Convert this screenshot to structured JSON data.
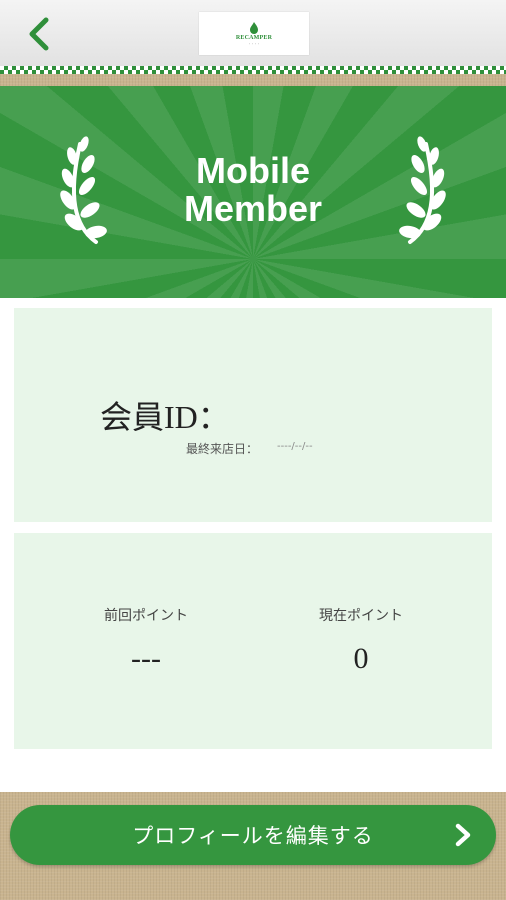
{
  "header": {
    "back_icon": "chevron-left-icon",
    "logo_text": "RECAMPER",
    "logo_subtext": "・・・・"
  },
  "banner": {
    "title_line1": "Mobile",
    "title_line2": "Member",
    "wreath_icon": "laurel-icon"
  },
  "member": {
    "id_label": "会員ID：",
    "last_visit_label": "最終来店日：",
    "last_visit_value": "----/--/--"
  },
  "points": {
    "previous_label": "前回ポイント",
    "previous_value": "---",
    "current_label": "現在ポイント",
    "current_value": "0"
  },
  "footer": {
    "edit_profile_label": "プロフィールを編集する",
    "chevron_icon": "chevron-right-icon"
  },
  "colors": {
    "brand_green": "#35963f",
    "card_bg": "#e8f6e9"
  }
}
